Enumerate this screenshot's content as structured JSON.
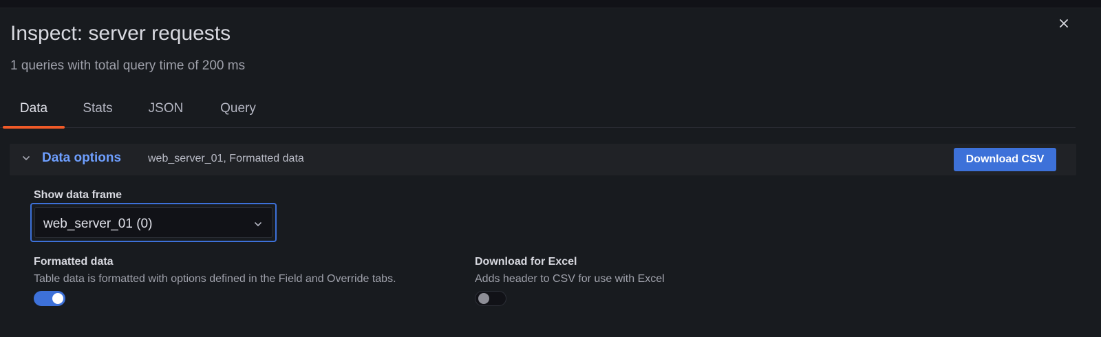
{
  "header": {
    "title": "Inspect: server requests",
    "subtitle": "1 queries with total query time of 200 ms"
  },
  "tabs": [
    {
      "label": "Data",
      "active": true
    },
    {
      "label": "Stats",
      "active": false
    },
    {
      "label": "JSON",
      "active": false
    },
    {
      "label": "Query",
      "active": false
    }
  ],
  "data_options": {
    "title": "Data options",
    "summary": "web_server_01, Formatted data",
    "download_label": "Download CSV",
    "show_frame_label": "Show data frame",
    "selected_frame": "web_server_01 (0)",
    "formatted": {
      "label": "Formatted data",
      "description": "Table data is formatted with options defined in the Field and Override tabs.",
      "enabled": true
    },
    "excel": {
      "label": "Download for Excel",
      "description": "Adds header to CSV for use with Excel",
      "enabled": false
    }
  },
  "icons": {
    "close": "close-icon",
    "collapse": "chevron-down-icon",
    "select": "chevron-down-icon"
  },
  "colors": {
    "accent_blue": "#3d71d9",
    "tab_underline": "#f05a28",
    "link_blue": "#6e9fff"
  }
}
